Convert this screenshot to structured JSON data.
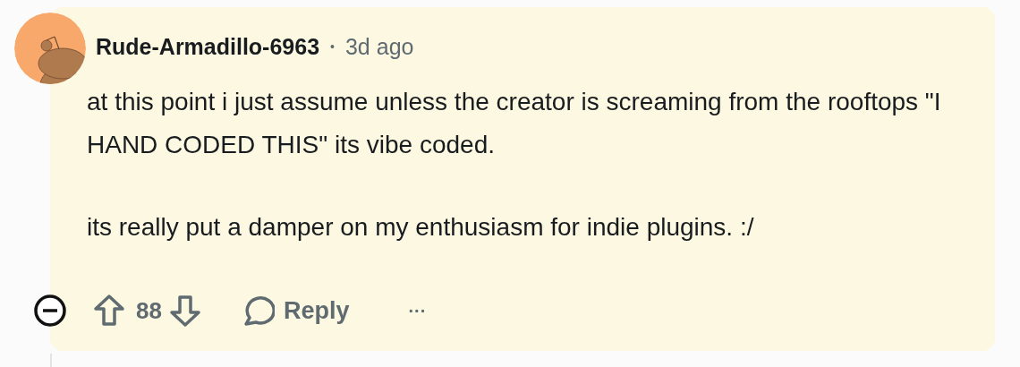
{
  "comment": {
    "author": "Rude-Armadillo-6963",
    "separator": "•",
    "time": "3d ago",
    "paragraphs": [
      "at this point i just assume unless the creator is screaming from the rooftops \"I HAND CODED THIS\" its vibe coded.",
      "its really put a damper on my enthusiasm for indie plugins. :/"
    ],
    "expanded": true,
    "score": "88",
    "reply_label": "Reply",
    "more": "···"
  }
}
